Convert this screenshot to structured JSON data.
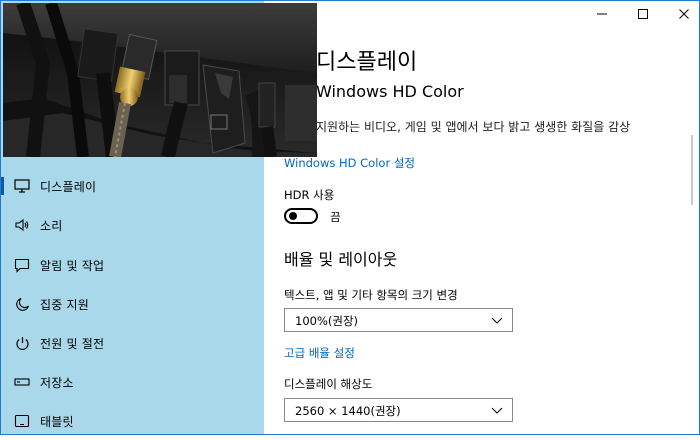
{
  "window": {
    "controls": {
      "minimize": "—",
      "maximize": "☐",
      "close": "✕"
    }
  },
  "sidebar": {
    "items": [
      {
        "label": "디스플레이",
        "icon": "monitor-icon",
        "active": true
      },
      {
        "label": "소리",
        "icon": "speaker-icon",
        "active": false
      },
      {
        "label": "알림 및 작업",
        "icon": "notification-icon",
        "active": false
      },
      {
        "label": "집중 지원",
        "icon": "moon-icon",
        "active": false
      },
      {
        "label": "전원 및 절전",
        "icon": "power-icon",
        "active": false
      },
      {
        "label": "저장소",
        "icon": "storage-icon",
        "active": false
      },
      {
        "label": "태블릿",
        "icon": "tablet-icon",
        "active": false
      }
    ]
  },
  "main": {
    "title": "디스플레이",
    "hd_section": {
      "heading": "Windows HD Color",
      "description": "지원하는 비디오, 게임 및 앱에서 보다 밝고 생생한 화질을 감상",
      "settings_link": "Windows HD Color 설정"
    },
    "hdr": {
      "label": "HDR 사용",
      "state": "끔",
      "on": false
    },
    "layout": {
      "heading": "배율 및 레이아웃",
      "scale_label": "텍스트, 앱 및 기타 항목의 크기 변경",
      "scale_value": "100%(권장)",
      "advanced_link": "고급 배율 설정",
      "resolution_label": "디스플레이 해상도",
      "resolution_value": "2560 × 1440(권장)"
    }
  },
  "colors": {
    "sidebar_bg": "#a8d8ea",
    "link": "#0067c0",
    "accent": "#0a5aa8"
  }
}
